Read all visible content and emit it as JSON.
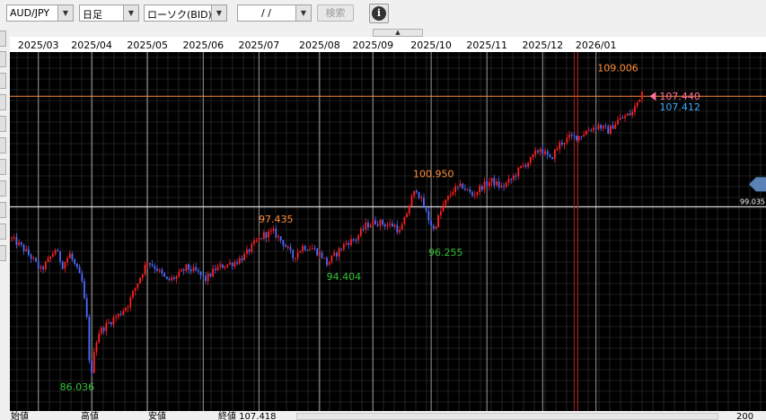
{
  "toolbar": {
    "pair": "AUD/JPY",
    "period": "日足",
    "chart_type": "ローソク(BID)",
    "date_value": "/ /",
    "search_label": "検索",
    "info_icon": "info-icon",
    "dropdown_arrow_icon": "triangle-down-icon"
  },
  "bottom": {
    "open_label": "始値",
    "high_label": "高値",
    "low_label": "安値",
    "close_label": "終値 107.418",
    "zoom_text": "200"
  },
  "colors": {
    "background": "#000000",
    "grid": "#3a3a3a",
    "up_candle": "#ff2020",
    "down_candle": "#4d6bff",
    "high_label": "#ff8c3a",
    "low_label": "#33c133",
    "bid_marker": "#ff6fa0",
    "ask_marker": "#3fa9f5",
    "orange_line": "#ff8c3a",
    "crosshair": "#ffffff",
    "red_vertical": "#b01c1c"
  },
  "chart_data": {
    "type": "candlestick",
    "x_labels": [
      "2025/03",
      "2025/04",
      "2025/05",
      "2025/06",
      "2025/07",
      "2025/08",
      "2025/09",
      "2025/10",
      "2025/11",
      "2025/12",
      "2026/01"
    ],
    "y_range": [
      83.5,
      110.8
    ],
    "annotations": {
      "highs": [
        {
          "label": "109.006",
          "date": "2026/01",
          "value": 109.006
        },
        {
          "label": "100.950",
          "date": "2025/09",
          "value": 100.95
        },
        {
          "label": "97.435",
          "date": "2025/07",
          "value": 97.435
        }
      ],
      "lows": [
        {
          "label": "86.036",
          "date": "2025/04",
          "value": 86.036
        },
        {
          "label": "94.404",
          "date": "2025/08",
          "value": 94.404
        },
        {
          "label": "96.255",
          "date": "2025/09",
          "value": 96.255
        }
      ]
    },
    "markers": {
      "bid": {
        "label": "107.440",
        "value": 107.44
      },
      "ask": {
        "label": "107.412",
        "value": 107.412
      },
      "crosshair": {
        "label": "99.035",
        "value": 99.035
      }
    },
    "horizontal_line": 107.44,
    "anchors": [
      {
        "d": 0,
        "v": 96.6
      },
      {
        "d": 4,
        "v": 96.0
      },
      {
        "d": 8,
        "v": 95.2
      },
      {
        "d": 12,
        "v": 94.2
      },
      {
        "d": 15,
        "v": 94.9
      },
      {
        "d": 18,
        "v": 95.8
      },
      {
        "d": 21,
        "v": 94.6
      },
      {
        "d": 24,
        "v": 95.4
      },
      {
        "d": 27,
        "v": 94.2
      },
      {
        "d": 29,
        "v": 93.3
      },
      {
        "d": 31,
        "v": 90.5
      },
      {
        "d": 32,
        "v": 87.5
      },
      {
        "d": 33,
        "v": 86.2
      },
      {
        "d": 34,
        "v": 88.2
      },
      {
        "d": 36,
        "v": 89.5
      },
      {
        "d": 40,
        "v": 90.2
      },
      {
        "d": 44,
        "v": 90.8
      },
      {
        "d": 48,
        "v": 91.6
      },
      {
        "d": 52,
        "v": 93.3
      },
      {
        "d": 56,
        "v": 94.9
      },
      {
        "d": 60,
        "v": 94.3
      },
      {
        "d": 64,
        "v": 93.4
      },
      {
        "d": 68,
        "v": 93.7
      },
      {
        "d": 72,
        "v": 94.4
      },
      {
        "d": 76,
        "v": 94.1
      },
      {
        "d": 80,
        "v": 93.5
      },
      {
        "d": 84,
        "v": 94.3
      },
      {
        "d": 88,
        "v": 94.6
      },
      {
        "d": 92,
        "v": 94.8
      },
      {
        "d": 96,
        "v": 95.3
      },
      {
        "d": 100,
        "v": 96.2
      },
      {
        "d": 104,
        "v": 96.9
      },
      {
        "d": 108,
        "v": 97.1
      },
      {
        "d": 112,
        "v": 96.3
      },
      {
        "d": 116,
        "v": 95.2
      },
      {
        "d": 120,
        "v": 96.0
      },
      {
        "d": 124,
        "v": 95.9
      },
      {
        "d": 128,
        "v": 95.3
      },
      {
        "d": 130,
        "v": 94.7
      },
      {
        "d": 134,
        "v": 95.5
      },
      {
        "d": 138,
        "v": 96.3
      },
      {
        "d": 142,
        "v": 96.6
      },
      {
        "d": 146,
        "v": 97.6
      },
      {
        "d": 150,
        "v": 97.9
      },
      {
        "d": 154,
        "v": 97.7
      },
      {
        "d": 158,
        "v": 97.6
      },
      {
        "d": 160,
        "v": 97.1
      },
      {
        "d": 162,
        "v": 98.0
      },
      {
        "d": 165,
        "v": 99.7
      },
      {
        "d": 167,
        "v": 100.4
      },
      {
        "d": 170,
        "v": 99.0
      },
      {
        "d": 172,
        "v": 98.1
      },
      {
        "d": 174,
        "v": 97.3
      },
      {
        "d": 176,
        "v": 98.2
      },
      {
        "d": 178,
        "v": 99.1
      },
      {
        "d": 182,
        "v": 100.3
      },
      {
        "d": 186,
        "v": 100.6
      },
      {
        "d": 190,
        "v": 99.9
      },
      {
        "d": 194,
        "v": 100.6
      },
      {
        "d": 198,
        "v": 101.0
      },
      {
        "d": 202,
        "v": 100.5
      },
      {
        "d": 206,
        "v": 101.1
      },
      {
        "d": 210,
        "v": 102.0
      },
      {
        "d": 214,
        "v": 102.6
      },
      {
        "d": 218,
        "v": 103.5
      },
      {
        "d": 222,
        "v": 102.6
      },
      {
        "d": 226,
        "v": 103.8
      },
      {
        "d": 230,
        "v": 104.3
      },
      {
        "d": 234,
        "v": 104.4
      },
      {
        "d": 238,
        "v": 104.9
      },
      {
        "d": 242,
        "v": 105.2
      },
      {
        "d": 246,
        "v": 104.8
      },
      {
        "d": 250,
        "v": 105.6
      },
      {
        "d": 254,
        "v": 106.0
      },
      {
        "d": 256,
        "v": 106.2
      },
      {
        "d": 258,
        "v": 107.0
      },
      {
        "d": 260,
        "v": 107.8
      }
    ]
  }
}
